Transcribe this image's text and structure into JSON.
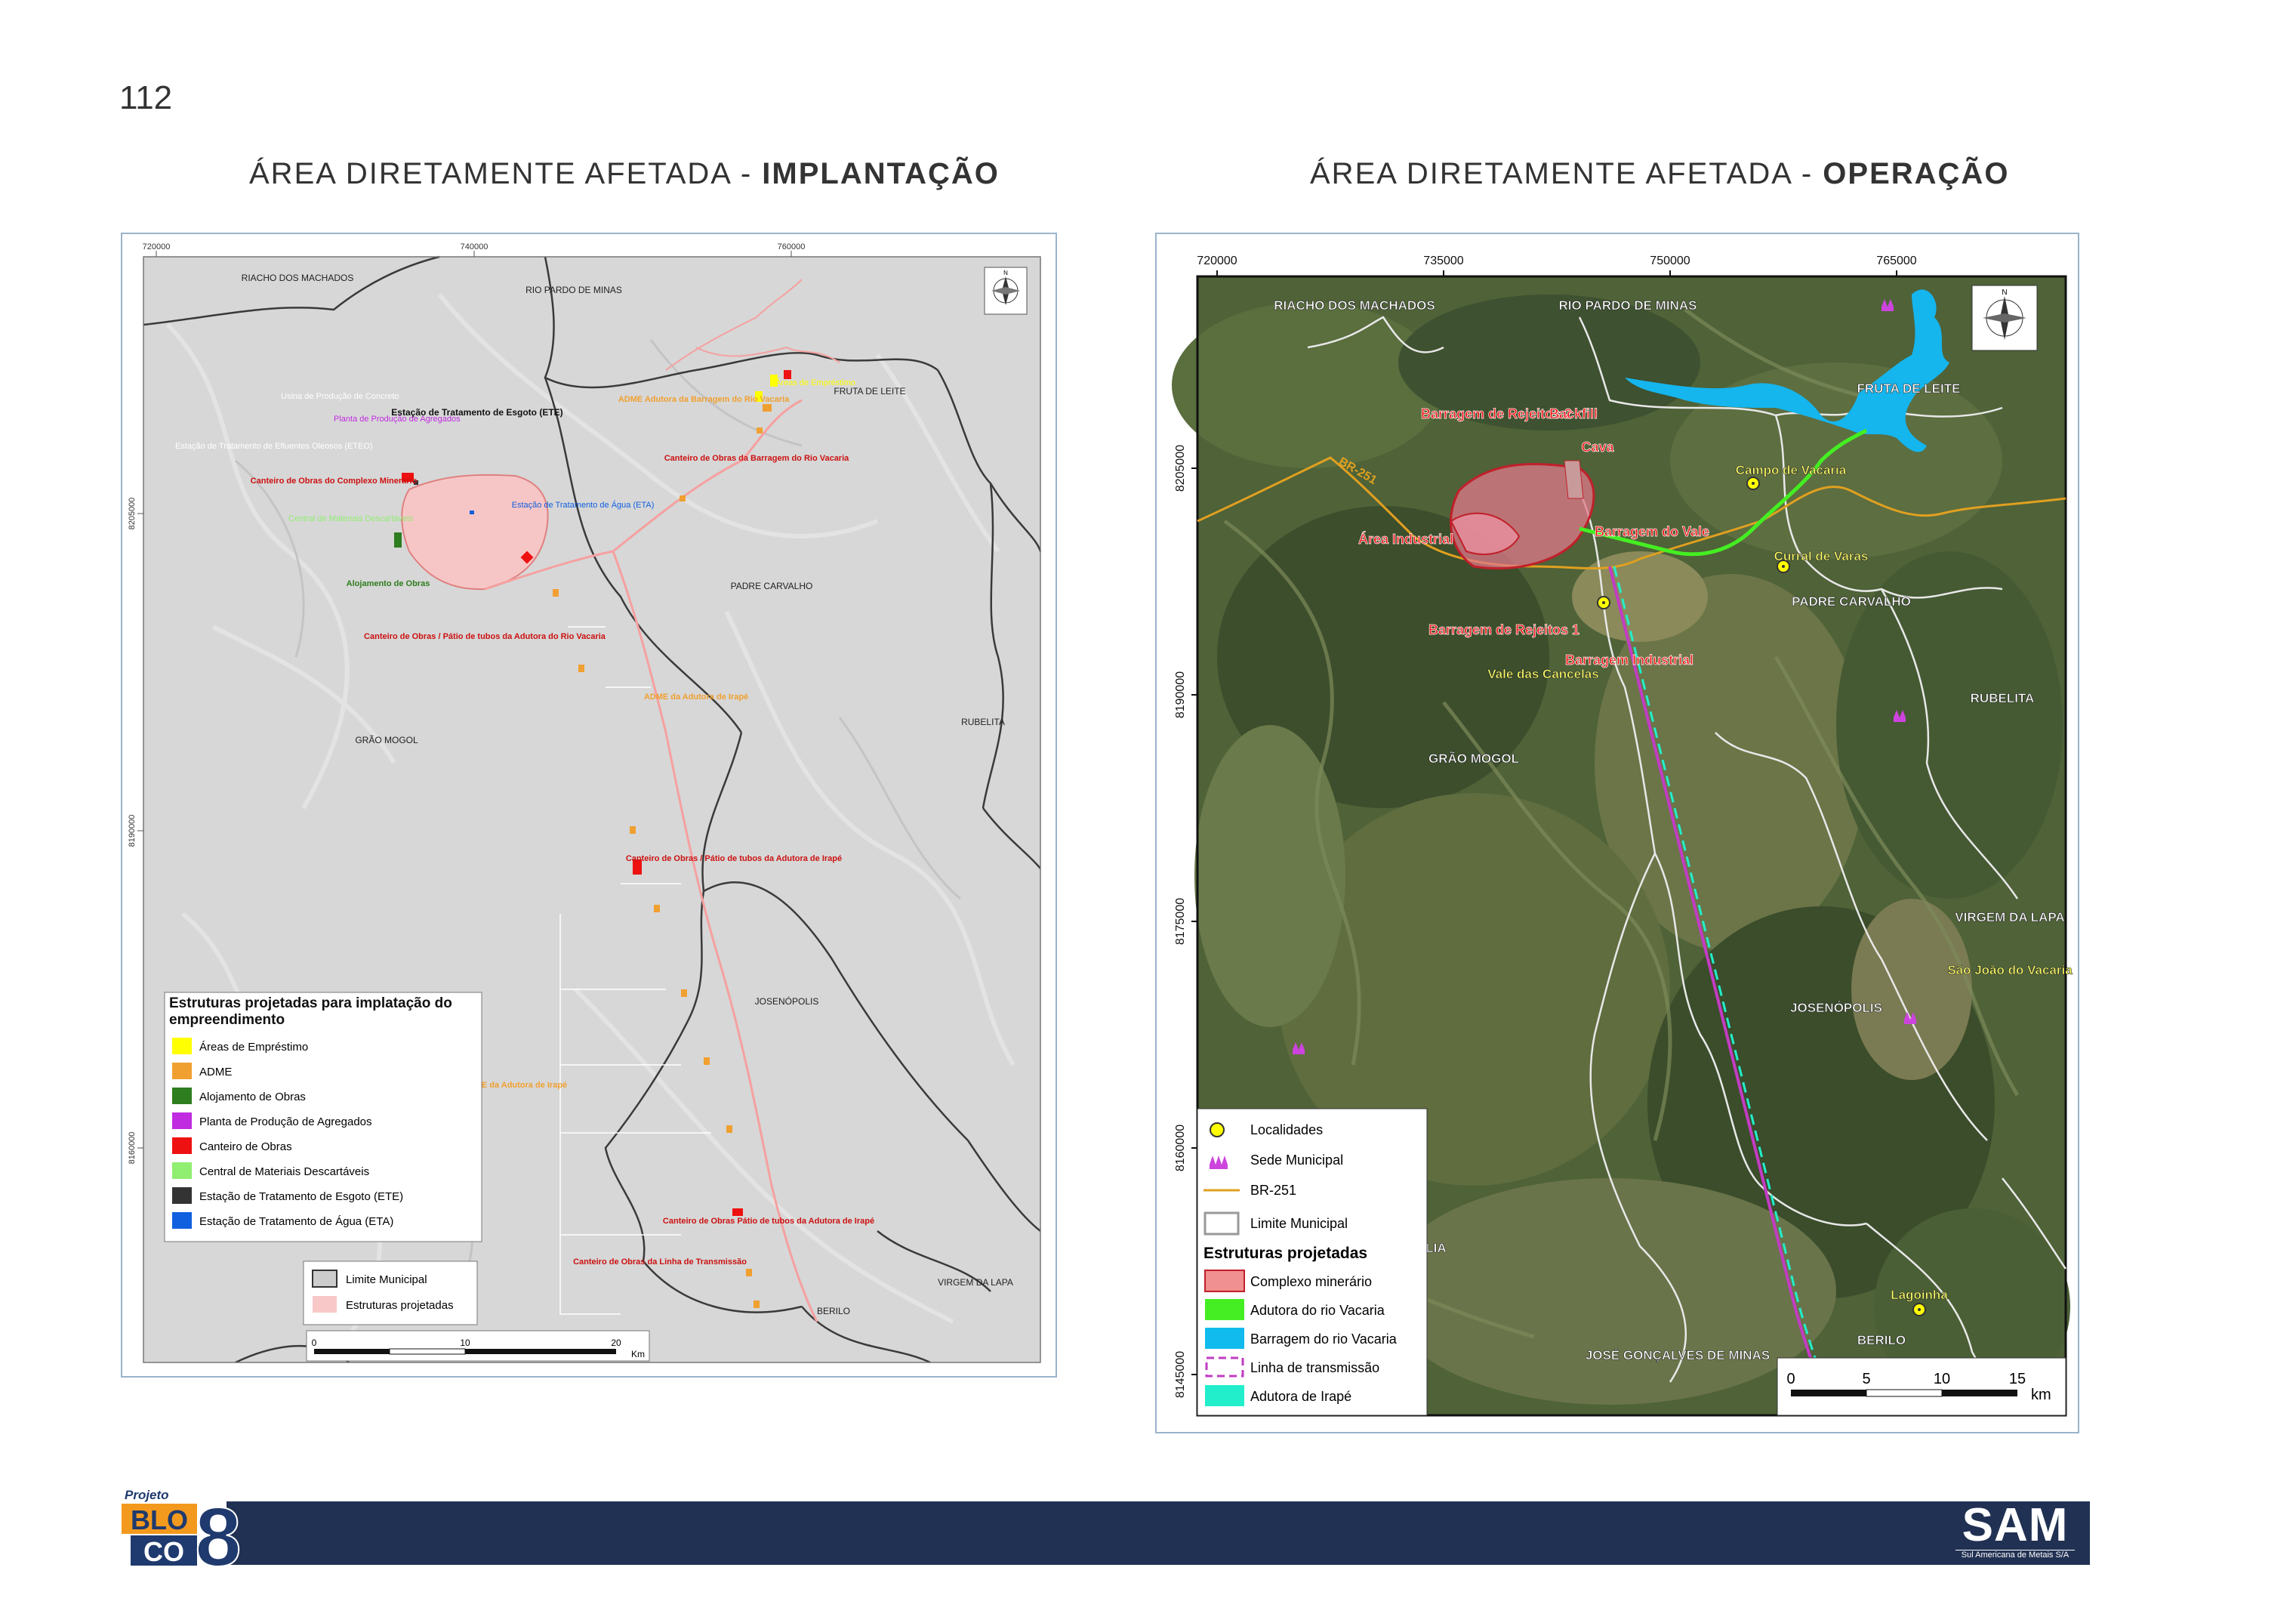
{
  "page": {
    "number": "112"
  },
  "titles": {
    "left": {
      "prefix": "ÁREA DIRETAMENTE AFETADA - ",
      "bold": "IMPLANTAÇÃO"
    },
    "right": {
      "prefix": "ÁREA DIRETAMENTE AFETADA - ",
      "bold": "OPERAÇÃO"
    }
  },
  "left_map": {
    "grid_x": [
      "720000",
      "740000",
      "760000"
    ],
    "grid_y": [
      "8205000",
      "8190000",
      "8160000"
    ],
    "municipalities": [
      "RIACHO DOS MACHADOS",
      "RIO PARDO DE MINAS",
      "FRUTA DE LEITE",
      "PADRE CARVALHO",
      "RUBELITA",
      "GRÃO MOGOL",
      "JOSENÓPOLIS",
      "VIRGEM DA LAPA",
      "BERILO"
    ],
    "labels": {
      "usina": "Usina de Produção de Concreto",
      "planta": "Planta de Produção de Agregados",
      "ete": "Estação de Tratamento de Esgoto (ETE)",
      "eteo": "Estação de Tratamento de Efluentes Oleosos (ETEO)",
      "canteiro_complexo": "Canteiro de Obras do Complexo Minerário",
      "alojamento": "Alojamento de Obras",
      "central_green": "Central de Materiais Descartáveis",
      "eta": "Estação de Tratamento de Água (ETA)",
      "adme_barragem": "ADME Adutora da Barragem do Rio Vacaria",
      "canteiro_barragem": "Canteiro de Obras da Barragem do Rio Vacaria",
      "areas_emprestimo": "Áreas de Empréstimo",
      "canteiro_patio_vacaria": "Canteiro de Obras / Pátio de tubos da Adutora do Rio Vacaria",
      "adme_irape_1": "ADME da Adutora de Irapé",
      "canteiro_patio_irape_1": "Canteiro de Obras / Pátio de tubos da Adutora de Irapé",
      "adme_irape_2": "ADME da Adutora de Irapé",
      "canteiro_patio_irape_2": "Canteiro de Obras Pátio de tubos da Adutora de Irapé",
      "canteiro_linha": "Canteiro de Obras da Linha de Transmissão"
    },
    "legend": {
      "title": "Estruturas projetadas para implatação do empreendimento",
      "items": [
        {
          "label": "Áreas de Empréstimo",
          "color": "#ffff00"
        },
        {
          "label": "ADME",
          "color": "#f0a030"
        },
        {
          "label": "Alojamento de Obras",
          "color": "#2e7d1e"
        },
        {
          "label": "Planta de Produção de Agregados",
          "color": "#c02ce0"
        },
        {
          "label": "Canteiro de Obras",
          "color": "#ee1111"
        },
        {
          "label": "Central de Materiais Descartáveis",
          "color": "#90ee70"
        },
        {
          "label": "Estação de Tratamento de Esgoto (ETE)",
          "color": "#333333"
        },
        {
          "label": "Estação de Tratamento de Água (ETA)",
          "color": "#1060e0"
        }
      ]
    },
    "legend2": {
      "items": [
        {
          "label": "Limite Municipal",
          "color": "#cccccc"
        },
        {
          "label": "Estruturas projetadas",
          "color": "#f8c8c8"
        }
      ]
    },
    "scale": {
      "ticks": [
        "0",
        "10",
        "20"
      ],
      "unit": "Km"
    }
  },
  "right_map": {
    "grid_x": [
      "720000",
      "735000",
      "750000",
      "765000"
    ],
    "grid_y": [
      "8205000",
      "8190000",
      "8175000",
      "8160000",
      "8145000"
    ],
    "municipalities": [
      "RIACHO DOS MACHADOS",
      "RIO PARDO DE MINAS",
      "FRUTA DE LEITE",
      "PADRE CARVALHO",
      "RUBELITA",
      "GRÃO MOGOL",
      "VIRGEM DA LAPA",
      "JOSENÓPOLIS",
      "BERILO",
      "JOSÉ GONÇALVES DE MINAS",
      "LIA"
    ],
    "localities": [
      "Campo de Vacaria",
      "Curral de Varas",
      "Vale das Cancelas",
      "São João do Vacaria",
      "Lagoinha"
    ],
    "structures": [
      "Barragem de Rejeitos 2",
      "Backfill",
      "Cava",
      "Área Industrial",
      "Barragem do Vale",
      "Barragem de Rejeitos 1",
      "Barragem Industrial"
    ],
    "road": "BR-251",
    "legend": {
      "items": [
        {
          "label": "Localidades",
          "symbol": "locality"
        },
        {
          "label": "Sede Municipal",
          "symbol": "seat"
        },
        {
          "label": "BR-251",
          "symbol": "road"
        },
        {
          "label": "Limite Municipal",
          "symbol": "limit"
        }
      ],
      "title": "Estruturas projetadas",
      "items2": [
        {
          "label": "Complexo minerário",
          "color": "#f09090"
        },
        {
          "label": "Adutora do rio Vacaria",
          "color": "#44ee22"
        },
        {
          "label": "Barragem do rio Vacaria",
          "color": "#11bbee"
        },
        {
          "label": "Linha de transmissão",
          "color": "#c23cc2"
        },
        {
          "label": "Adutora de Irapé",
          "color": "#22eecc"
        }
      ]
    },
    "scale": {
      "ticks": [
        "0",
        "5",
        "10",
        "15"
      ],
      "unit": "km"
    }
  },
  "footer": {
    "bloco": {
      "projeto": "Projeto",
      "line1": "BLO",
      "line2": "CO",
      "number": "8"
    },
    "sam": {
      "word": "SAM",
      "tagline": "Sul Americana de Metais S/A"
    }
  }
}
